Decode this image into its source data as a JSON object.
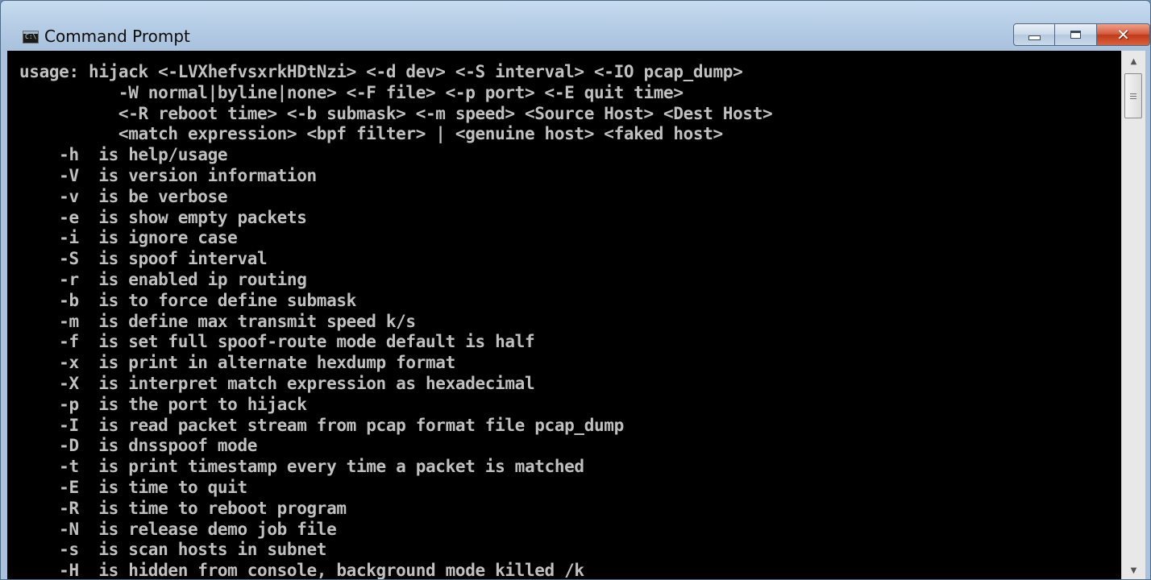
{
  "window": {
    "title": "Command Prompt",
    "icon": "console-icon",
    "icon_text": "C:\\"
  },
  "caption_buttons": {
    "minimize": "minimize-icon",
    "maximize": "maximize-icon",
    "close": "close-icon",
    "close_glyph": "✕"
  },
  "scrollbar": {
    "up_glyph": "▲",
    "down_glyph": "▼"
  },
  "console": {
    "lines": [
      "usage: hijack <-LVXhefvsxrkHDtNzi> <-d dev> <-S interval> <-IO pcap_dump>",
      "          -W normal|byline|none> <-F file> <-p port> <-E quit time>",
      "          <-R reboot time> <-b submask> <-m speed> <Source Host> <Dest Host>",
      "          <match expression> <bpf filter> | <genuine host> <faked host>",
      "    -h  is help/usage",
      "    -V  is version information",
      "    -v  is be verbose",
      "    -e  is show empty packets",
      "    -i  is ignore case",
      "    -S  is spoof interval",
      "    -r  is enabled ip routing",
      "    -b  is to force define submask",
      "    -m  is define max transmit speed k/s",
      "    -f  is set full spoof-route mode default is half",
      "    -x  is print in alternate hexdump format",
      "    -X  is interpret match expression as hexadecimal",
      "    -p  is the port to hijack",
      "    -I  is read packet stream from pcap format file pcap_dump",
      "    -D  is dnsspoof mode",
      "    -t  is print timestamp every time a packet is matched",
      "    -E  is time to quit",
      "    -R  is time to reboot program",
      "    -N  is release demo job file",
      "    -s  is scan hosts in subnet",
      "    -H  is hidden from console, background mode killed /k"
    ]
  }
}
